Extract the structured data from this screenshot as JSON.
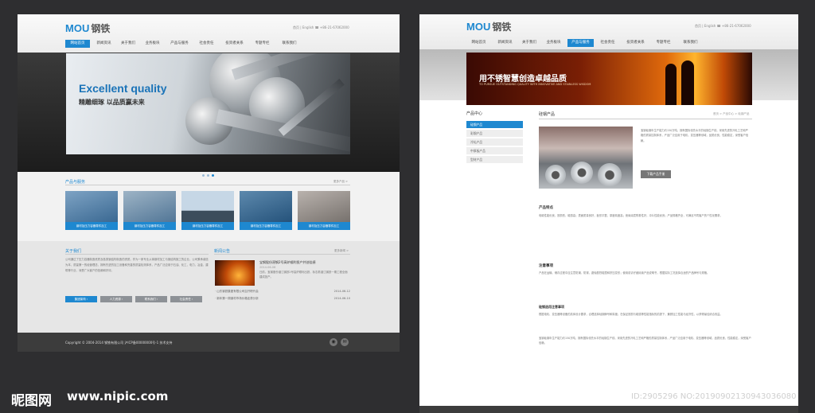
{
  "brand": {
    "logo": "MOU",
    "logo_cn": "钢铁"
  },
  "top_links": "首页 | English  ☎ +86-21-67062000",
  "nav": [
    "网站首页",
    "新闻资讯",
    "关于我们",
    "业务板块",
    "产品与服务",
    "社会责任",
    "投资者关系",
    "专题专栏",
    "联系我们"
  ],
  "left_page": {
    "active_nav": 0,
    "banner": {
      "title": "Excellent quality",
      "subtitle": "精雕细琢  以品质赢未来",
      "slide_count": 3,
      "active_slide": 2
    },
    "products": {
      "title": "产品与服务",
      "more": "更多产品 >",
      "items": [
        "钢材及压力容器零件加工",
        "钢材及压力容器零件加工",
        "钢材及压力容器零件加工",
        "钢材及压力容器零件加工",
        "钢材及压力容器零件加工"
      ]
    },
    "about": {
      "title": "关于我们",
      "text": "公司通过了压力容器制造资质及各类钢结构制造的资质。作为一家专业从事钢材加工与钢结构施工的企业，公司秉承诚信为本、质量第一的经营理念，拥有先进的加工设备和完善的质量检测体系，产品广泛应用于石油、化工、电力、冶金、建筑等行业，深受广大客户的信赖和好评。",
      "buttons": [
        "集团架构 ›",
        "人力资源 ›",
        "联系我们 ›",
        "社会责任 ›"
      ],
      "active_button": 0
    },
    "news": {
      "title": "新闻公告",
      "more": "更多新闻 >",
      "featured_title": "宝钢股份湛钢2号高炉顺利投产并创佳绩",
      "featured_date": "2014-06-08",
      "featured_text": "日前，宝钢股份湛江钢铁2号高炉顺利出铁，标志着湛江钢铁一期工程全面建成投产。",
      "items": [
        {
          "title": "山东钢铁集团有限公司召开职代会",
          "date": "2014-06-12"
        },
        {
          "title": "新年第一周钢材市场价格走势分析",
          "date": "2014-06-10"
        }
      ]
    },
    "footer": "Copyright © 2004-2014 钢铁有限公司 沪ICP备00000000号-1 技术支持"
  },
  "right_page": {
    "active_nav": 4,
    "banner": {
      "title": "用不锈智慧创造卓越品质",
      "subtitle": "TO PURSUE OUTSTANDING QUALITY WITH INNOVATIVE AND STAINLESS WISDOM"
    },
    "sidebar": {
      "title": "产品中心",
      "items": [
        "硅钢产品",
        "彩钢产品",
        "冷轧产品",
        "中厚板产品",
        "型材产品"
      ],
      "active": 0
    },
    "content": {
      "title": "硅钢产品",
      "breadcrumb": "首页 > 产品中心 > 硅钢产品",
      "intro": "宝钢硅钢年生产能力约150万吨，拥有国际领先水平的硅钢生产线，采用先进的冷轧工艺和严格的质量控制体系，产品广泛应用于电机、变压器等领域，品质优良，性能稳定，深受客户信赖。",
      "download": "下载产品手册",
      "sections": [
        {
          "title": "产品特点",
          "text": "电磁性能优良，铁损低、磁感高；表面质量良好，板形平整，厚度精度高；绝缘涂层附着性好，冲片性能优良；产品规格齐全，可满足不同客户的个性化需求。"
        },
        {
          "title": "注意事项",
          "text": "产品在运输、储存过程中应注意防潮、防锈，避免剧烈碰撞和挤压变形；使用前请仔细阅读产品说明书，根据实际工况选择合适的产品牌号与规格。"
        },
        {
          "title": "硅钢选用注意事项",
          "text": "根据电机、变压器等设备的具体设计要求，合理选择硅钢牌号和厚度；在保证铁损与磁感等性能指标的前提下，兼顾加工性能与经济性，以获得最佳综合效益。"
        }
      ]
    }
  },
  "watermark": {
    "logo": "昵图网",
    "url": "www.nipic.com",
    "id": "ID:2905296 NO:20190902130943036080"
  },
  "colors": {
    "accent": "#1e88d0",
    "background": "#2e2e30",
    "footer": "#3c3c3c"
  }
}
